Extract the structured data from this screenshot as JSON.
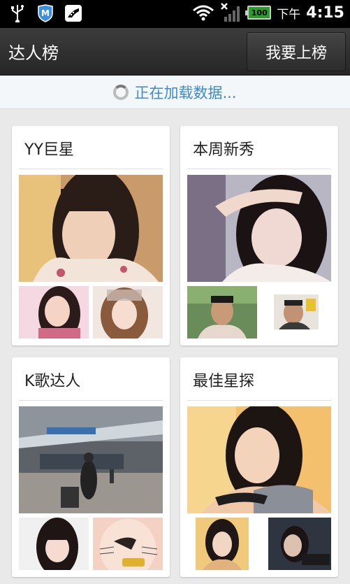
{
  "status_bar": {
    "icons": [
      "usb-icon",
      "shield-icon",
      "shoe-app-icon",
      "wifi-icon",
      "signal-off-icon",
      "battery-icon"
    ],
    "battery": "100",
    "ampm": "下午",
    "time": "4:15"
  },
  "header": {
    "title": "达人榜",
    "action_button": "我要上榜"
  },
  "loading": {
    "text": "正在加载数据..."
  },
  "cards": [
    {
      "title": "YY巨星"
    },
    {
      "title": "本周新秀"
    },
    {
      "title": "K歌达人"
    },
    {
      "title": "最佳星探"
    }
  ]
}
